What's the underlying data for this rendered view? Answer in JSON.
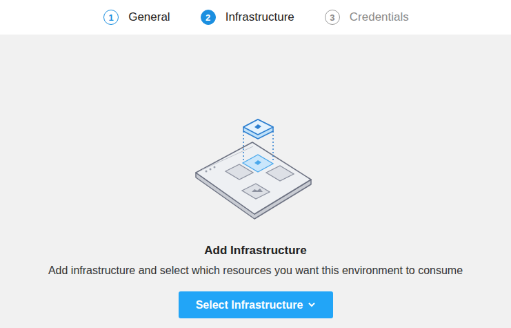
{
  "steps": [
    {
      "number": "1",
      "label": "General",
      "selected": false,
      "disabled": false
    },
    {
      "number": "2",
      "label": "Infrastructure",
      "selected": true,
      "disabled": false
    },
    {
      "number": "3",
      "label": "Credentials",
      "selected": false,
      "disabled": true
    }
  ],
  "empty_state": {
    "title": "Add Infrastructure",
    "description": "Add infrastructure and select which resources you want this environment to consume",
    "button": "Select Infrastructure"
  }
}
